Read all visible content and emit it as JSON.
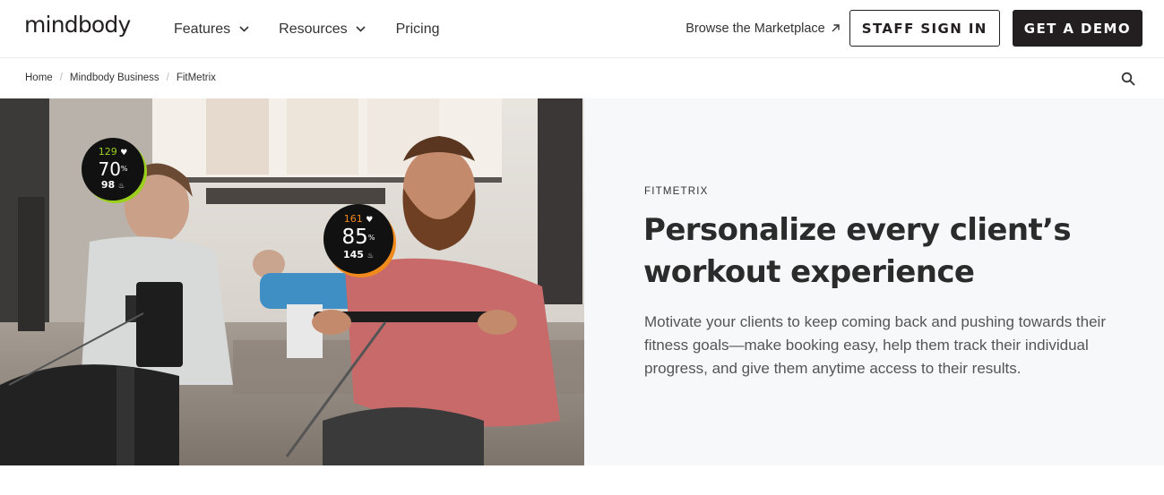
{
  "brand": {
    "logo_text": "mindbody"
  },
  "nav": {
    "items": [
      {
        "label": "Features",
        "has_dropdown": true
      },
      {
        "label": "Resources",
        "has_dropdown": true
      },
      {
        "label": "Pricing",
        "has_dropdown": false
      }
    ],
    "marketplace_link": "Browse the Marketplace",
    "staff_sign_in": "STAFF SIGN IN",
    "get_demo": "GET A DEMO"
  },
  "breadcrumb": [
    "Home",
    "Mindbody Business",
    "FitMetrix"
  ],
  "hero": {
    "eyebrow": "FITMETRIX",
    "headline": "Personalize every client’s workout experience",
    "subtext": "Motivate your clients to keep coming back and pushing towards their fitness goals—make booking easy, help them track their individual progress, and give them anytime access to their results."
  },
  "badges": [
    {
      "heart_rate": "129",
      "percent": "70",
      "percent_unit": "%",
      "calories": "98",
      "accent": "#9bd11e"
    },
    {
      "heart_rate": "161",
      "percent": "85",
      "percent_unit": "%",
      "calories": "145",
      "accent": "#f08a1c"
    }
  ],
  "icons": {
    "chevron": "chevron-down-icon",
    "external": "external-arrow-icon",
    "search": "search-icon",
    "heart": "heart-icon",
    "flame": "flame-icon"
  }
}
